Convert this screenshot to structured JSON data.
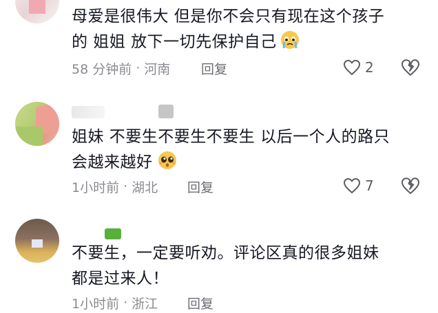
{
  "comments": [
    {
      "text_line1": "母爱是很伟大 但是你不会只有现在这个孩子",
      "text_line2": "的 姐姐 放下一切先保护自己",
      "time": "58 分钟前",
      "location": "河南",
      "reply": "回复",
      "likes": "2",
      "emoji": "crying-face-icon"
    },
    {
      "text_line1": "姐妹 不要生不要生不要生 以后一个人的路只",
      "text_line2": "会越来越好",
      "time": "1小时前",
      "location": "湖北",
      "reply": "回复",
      "likes": "7",
      "emoji": "pleading-face-icon"
    },
    {
      "text_line1": "不要生，一定要听劝。评论区真的很多姐妹",
      "text_line2": "都是过来人！",
      "time": "1小时前",
      "location": "浙江",
      "reply": "回复"
    }
  ],
  "separator": "·",
  "colors": {
    "text": "#161823",
    "meta": "#8a8b91",
    "icon": "#5b5c61"
  }
}
